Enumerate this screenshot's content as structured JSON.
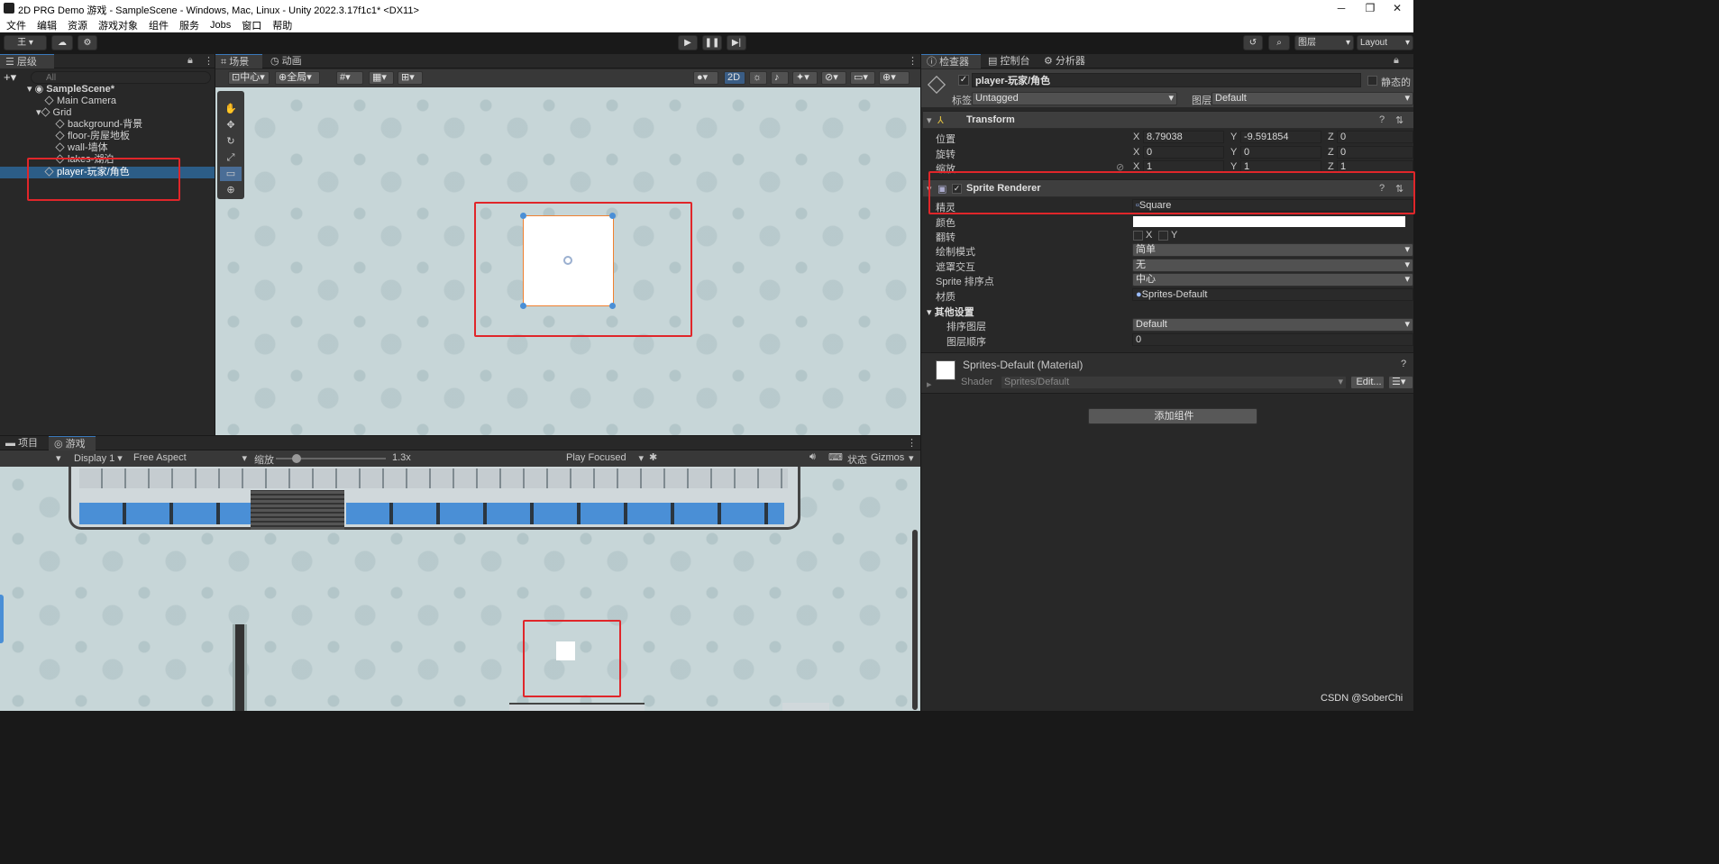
{
  "window": {
    "title": "2D PRG Demo 游戏 - SampleScene - Windows, Mac, Linux - Unity 2022.3.17f1c1* <DX11>",
    "minimize": "─",
    "restore": "❐",
    "close": "✕"
  },
  "menu": [
    "文件",
    "编辑",
    "资源",
    "游戏对象",
    "组件",
    "服务",
    "Jobs",
    "窗口",
    "帮助"
  ],
  "toolbar": {
    "account": "王 ▾",
    "search_icon": "⌕",
    "layers": "图层",
    "layout": "Layout"
  },
  "hierarchy": {
    "tab": "层级",
    "search_placeholder": "All",
    "scene": "SampleScene*",
    "items": [
      "Main Camera",
      "Grid",
      "background-背景",
      "floor-房屋地板",
      "wall-墙体",
      "lakes-湖泊",
      "player-玩家/角色"
    ]
  },
  "scene_view": {
    "tab_scene": "场景",
    "tab_anim": "动画",
    "pivot": "中心",
    "global": "全局",
    "mode_2d": "2D"
  },
  "game_view": {
    "tab_project": "项目",
    "tab_game": "游戏",
    "display": "Display 1",
    "aspect": "Free Aspect",
    "scale_label": "缩放",
    "scale_value": "1.3x",
    "play_mode": "Play Focused",
    "stats": "状态",
    "gizmos": "Gizmos"
  },
  "inspector": {
    "tab_inspector": "检查器",
    "tab_console": "控制台",
    "tab_analyzer": "分析器",
    "object_name": "player-玩家/角色",
    "static_label": "静态的",
    "tag_label": "标签",
    "tag_value": "Untagged",
    "layer_label": "图层",
    "layer_value": "Default",
    "transform": {
      "title": "Transform",
      "position_label": "位置",
      "rotation_label": "旋转",
      "scale_label": "缩放",
      "pos": {
        "x": "8.79038",
        "y": "-9.591854",
        "z": "0"
      },
      "rot": {
        "x": "0",
        "y": "0",
        "z": "0"
      },
      "scl": {
        "x": "1",
        "y": "1",
        "z": "1"
      }
    },
    "sprite_renderer": {
      "title": "Sprite Renderer",
      "sprite_label": "精灵",
      "sprite_value": "Square",
      "color_label": "颜色",
      "flip_label": "翻转",
      "flip_x": "X",
      "flip_y": "Y",
      "draw_mode_label": "绘制模式",
      "draw_mode_value": "简单",
      "mask_label": "遮罩交互",
      "mask_value": "无",
      "sort_point_label": "Sprite 排序点",
      "sort_point_value": "中心",
      "material_label": "材质",
      "material_value": "Sprites-Default",
      "other_label": "其他设置",
      "sorting_layer_label": "排序图层",
      "sorting_layer_value": "Default",
      "order_label": "图层顺序",
      "order_value": "0"
    },
    "material": {
      "name": "Sprites-Default (Material)",
      "shader_label": "Shader",
      "shader_value": "Sprites/Default",
      "edit": "Edit..."
    },
    "add_component": "添加组件"
  },
  "watermark": "CSDN @SoberChi",
  "colors": {
    "accent": "#3a79bb",
    "highlight_red": "#e0262a",
    "selection": "#2c5d87"
  }
}
